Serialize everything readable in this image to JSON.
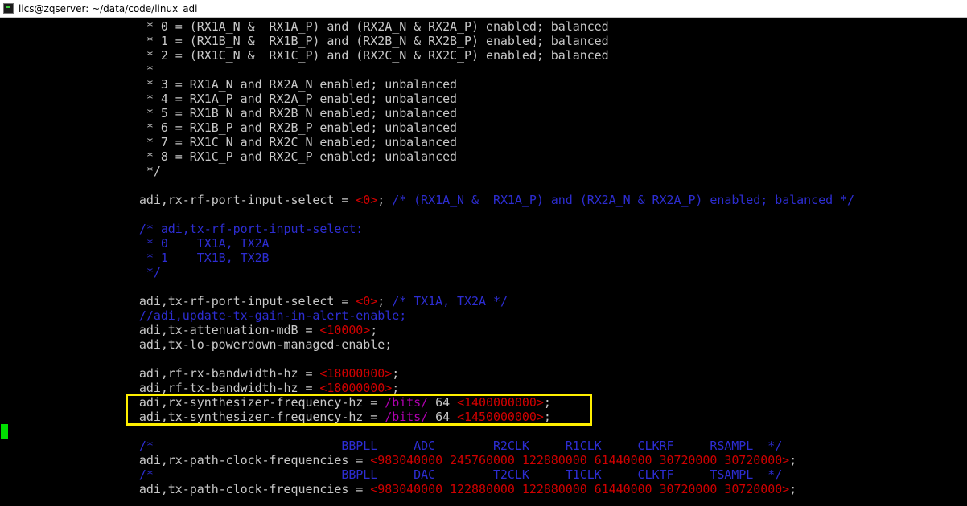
{
  "window": {
    "title": "lics@zqserver: ~/data/code/linux_adi",
    "icon": "terminal-icon"
  },
  "colors": {
    "background": "#000000",
    "text": "#c8c8c8",
    "comment": "#2d2dd2",
    "value": "#d00000",
    "macro": "#b000b0",
    "highlight": "#ffef00",
    "cursor": "#00e000"
  },
  "terminal": {
    "lines": [
      [
        {
          "t": "       * 0 = (RX1A_N &  RX1A_P) and (RX2A_N & RX2A_P) enabled; balanced",
          "c": "w"
        }
      ],
      [
        {
          "t": "       * 1 = (RX1B_N &  RX1B_P) and (RX2B_N & RX2B_P) enabled; balanced",
          "c": "w"
        }
      ],
      [
        {
          "t": "       * 2 = (RX1C_N &  RX1C_P) and (RX2C_N & RX2C_P) enabled; balanced",
          "c": "w"
        }
      ],
      [
        {
          "t": "       *",
          "c": "w"
        }
      ],
      [
        {
          "t": "       * 3 = RX1A_N and RX2A_N enabled; unbalanced",
          "c": "w"
        }
      ],
      [
        {
          "t": "       * 4 = RX1A_P and RX2A_P enabled; unbalanced",
          "c": "w"
        }
      ],
      [
        {
          "t": "       * 5 = RX1B_N and RX2B_N enabled; unbalanced",
          "c": "w"
        }
      ],
      [
        {
          "t": "       * 6 = RX1B_P and RX2B_P enabled; unbalanced",
          "c": "w"
        }
      ],
      [
        {
          "t": "       * 7 = RX1C_N and RX2C_N enabled; unbalanced",
          "c": "w"
        }
      ],
      [
        {
          "t": "       * 8 = RX1C_P and RX2C_P enabled; unbalanced",
          "c": "w"
        }
      ],
      [
        {
          "t": "       */",
          "c": "w"
        }
      ],
      [],
      [
        {
          "t": "      adi,rx-rf-port-input-select = ",
          "c": "w"
        },
        {
          "t": "<0>",
          "c": "r"
        },
        {
          "t": "; ",
          "c": "w"
        },
        {
          "t": "/* (RX1A_N &  RX1A_P) and (RX2A_N & RX2A_P) enabled; balanced */",
          "c": "b"
        }
      ],
      [],
      [
        {
          "t": "      /* adi,tx-rf-port-input-select:",
          "c": "b"
        }
      ],
      [
        {
          "t": "       * 0    TX1A, TX2A",
          "c": "b"
        }
      ],
      [
        {
          "t": "       * 1    TX1B, TX2B",
          "c": "b"
        }
      ],
      [
        {
          "t": "       */",
          "c": "b"
        }
      ],
      [],
      [
        {
          "t": "      adi,tx-rf-port-input-select = ",
          "c": "w"
        },
        {
          "t": "<0>",
          "c": "r"
        },
        {
          "t": "; ",
          "c": "w"
        },
        {
          "t": "/* TX1A, TX2A */",
          "c": "b"
        }
      ],
      [
        {
          "t": "      //adi,update-tx-gain-in-alert-enable;",
          "c": "b"
        }
      ],
      [
        {
          "t": "      adi,tx-attenuation-mdB = ",
          "c": "w"
        },
        {
          "t": "<10000>",
          "c": "r"
        },
        {
          "t": ";",
          "c": "w"
        }
      ],
      [
        {
          "t": "      adi,tx-lo-powerdown-managed-enable;",
          "c": "w"
        }
      ],
      [],
      [
        {
          "t": "      adi,rf-rx-bandwidth-hz = ",
          "c": "w"
        },
        {
          "t": "<18000000>",
          "c": "r"
        },
        {
          "t": ";",
          "c": "w"
        }
      ],
      [
        {
          "t": "      adi,rf-tx-bandwidth-hz = ",
          "c": "w"
        },
        {
          "t": "<18000000>",
          "c": "r"
        },
        {
          "t": ";",
          "c": "w"
        }
      ],
      [
        {
          "t": "      adi,rx-synthesizer-frequency-hz = ",
          "c": "w"
        },
        {
          "t": "/bits/",
          "c": "m"
        },
        {
          "t": " 64 ",
          "c": "w"
        },
        {
          "t": "<1400000000>",
          "c": "r"
        },
        {
          "t": ";",
          "c": "w"
        }
      ],
      [
        {
          "t": "      adi,tx-synthesizer-frequency-hz = ",
          "c": "w"
        },
        {
          "t": "/bits/",
          "c": "m"
        },
        {
          "t": " 64 ",
          "c": "w"
        },
        {
          "t": "<1450000000>",
          "c": "r"
        },
        {
          "t": ";",
          "c": "w"
        }
      ],
      [],
      [
        {
          "t": "      /*                          BBPLL     ADC        R2CLK     R1CLK     CLKRF     RSAMPL  */",
          "c": "b"
        }
      ],
      [
        {
          "t": "      adi,rx-path-clock-frequencies = ",
          "c": "w"
        },
        {
          "t": "<983040000 245760000 122880000 61440000 30720000 30720000>",
          "c": "r"
        },
        {
          "t": ";",
          "c": "w"
        }
      ],
      [
        {
          "t": "      /*                          BBPLL     DAC        T2CLK     T1CLK     CLKTF     TSAMPL  */",
          "c": "b"
        }
      ],
      [
        {
          "t": "      adi,tx-path-clock-frequencies = ",
          "c": "w"
        },
        {
          "t": "<983040000 122880000 122880000 61440000 30720000 30720000>",
          "c": "r"
        },
        {
          "t": ";",
          "c": "w"
        }
      ]
    ]
  }
}
